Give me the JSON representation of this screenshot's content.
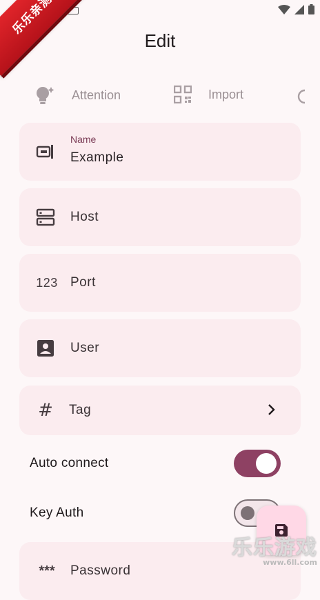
{
  "status_bar": {
    "icons": [
      "keyboard-icon",
      "wifi-icon",
      "signal-icon",
      "battery-icon"
    ]
  },
  "ribbon": {
    "text": "乐乐亲测"
  },
  "app_bar": {
    "title": "Edit"
  },
  "chips": [
    {
      "icon": "lightbulb-icon",
      "label": "Attention"
    },
    {
      "icon": "qr-code-icon",
      "label": "Import"
    }
  ],
  "fields": {
    "name": {
      "label": "Name",
      "value": "Example",
      "icon": "label-icon"
    },
    "host": {
      "placeholder": "Host",
      "icon": "server-icon"
    },
    "port": {
      "placeholder": "Port",
      "icon_text": "123"
    },
    "user": {
      "placeholder": "User",
      "icon": "account-box-icon"
    },
    "tag": {
      "label": "Tag",
      "icon_text": "#"
    },
    "password": {
      "placeholder": "Password",
      "icon_text": "***"
    }
  },
  "toggles": {
    "auto_connect": {
      "label": "Auto connect",
      "on": true
    },
    "key_auth": {
      "label": "Key Auth",
      "on": false
    }
  },
  "fab": {
    "icon": "save-icon"
  },
  "watermark": {
    "title": "乐乐游戏",
    "url": "www.6ll.com"
  },
  "colors": {
    "primary": "#8e4163",
    "card": "#fbecef",
    "background": "#fdf7f8",
    "fab": "#ffd8e6"
  }
}
